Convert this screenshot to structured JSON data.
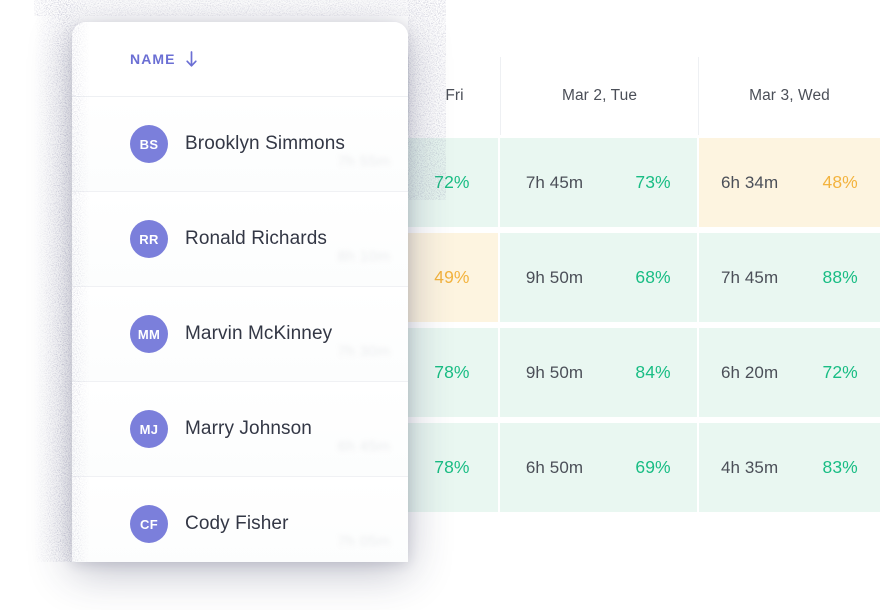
{
  "panel": {
    "header": {
      "label": "NAME",
      "sort_icon": "arrow-down-icon",
      "sort_direction": "descending"
    },
    "accent_color": "#6b6fd4",
    "avatar_color": "#7b7fdb",
    "people": [
      {
        "initials": "BS",
        "name": "Brooklyn Simmons",
        "ghost": "7h 55m"
      },
      {
        "initials": "RR",
        "name": "Ronald Richards",
        "ghost": "8h 10m"
      },
      {
        "initials": "MM",
        "name": "Marvin McKinney",
        "ghost": "7h 30m"
      },
      {
        "initials": "MJ",
        "name": "Marry Johnson",
        "ghost": "6h 45m"
      },
      {
        "initials": "CF",
        "name": "Cody Fisher",
        "ghost": "7h 05m"
      }
    ]
  },
  "table": {
    "columns": [
      {
        "id": "name",
        "label": ""
      },
      {
        "id": "mar1",
        "label": "Fri"
      },
      {
        "id": "mar2",
        "label": "Mar 2, Tue"
      },
      {
        "id": "mar3",
        "label": "Mar 3, Wed"
      }
    ],
    "colors": {
      "good_text": "#19bd84",
      "warn_text": "#f3b33e",
      "good_bg": "#e9f7f1",
      "warn_bg": "#fdf4e0",
      "hours_text": "#4b4f58"
    },
    "rows": [
      {
        "person": "Brooklyn Simmons",
        "cells": [
          {
            "day": "mar1",
            "percent": "72%",
            "status": "good"
          },
          {
            "day": "mar2",
            "hours": "7h 45m",
            "percent": "73%",
            "status": "good"
          },
          {
            "day": "mar3",
            "hours": "6h 34m",
            "percent": "48%",
            "status": "warn"
          }
        ]
      },
      {
        "person": "Ronald Richards",
        "cells": [
          {
            "day": "mar1",
            "percent": "49%",
            "status": "warn"
          },
          {
            "day": "mar2",
            "hours": "9h 50m",
            "percent": "68%",
            "status": "good"
          },
          {
            "day": "mar3",
            "hours": "7h 45m",
            "percent": "88%",
            "status": "good"
          }
        ]
      },
      {
        "person": "Marvin McKinney",
        "cells": [
          {
            "day": "mar1",
            "percent": "78%",
            "status": "good"
          },
          {
            "day": "mar2",
            "hours": "9h 50m",
            "percent": "84%",
            "status": "good"
          },
          {
            "day": "mar3",
            "hours": "6h 20m",
            "percent": "72%",
            "status": "good"
          }
        ]
      },
      {
        "person": "Marry Johnson",
        "cells": [
          {
            "day": "mar1",
            "percent": "78%",
            "status": "good"
          },
          {
            "day": "mar2",
            "hours": "6h 50m",
            "percent": "69%",
            "status": "good"
          },
          {
            "day": "mar3",
            "hours": "4h 35m",
            "percent": "83%",
            "status": "good"
          }
        ]
      },
      {
        "person": "Cody Fisher",
        "cells": []
      }
    ]
  }
}
